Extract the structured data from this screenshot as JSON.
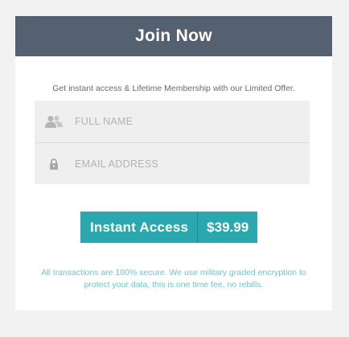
{
  "card": {
    "title": "Join Now",
    "intro": "Get instant access & Lifetime Membership with our Limited Offer."
  },
  "form": {
    "name_placeholder": "FULL NAME",
    "email_placeholder": "EMAIL ADDRESS",
    "name_icon": "user-icon",
    "email_icon": "lock-icon"
  },
  "cta": {
    "label": "Instant Access",
    "price": "$39.99"
  },
  "footer": {
    "note": "All transactions are 100% secure. We use military graded encryption to protect your data, this is one time fee, no rebills."
  },
  "colors": {
    "header": "#556070",
    "accent": "#2aa8ad",
    "note": "#6cc6c9"
  }
}
